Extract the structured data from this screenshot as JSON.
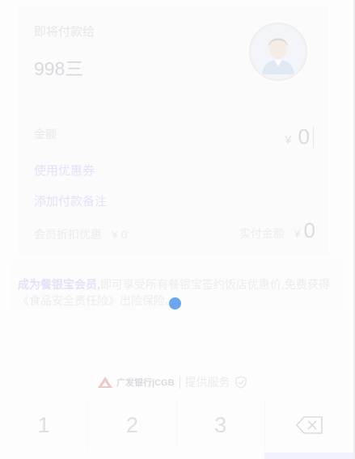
{
  "payment": {
    "pay_to_label": "即将付款给",
    "merchant_name": "998三",
    "amount_label": "金额",
    "currency_symbol": "¥",
    "amount_value": "0",
    "use_coupon_label": "使用优惠券",
    "add_remark_label": "添加付款备注",
    "member_discount_label": "会员折扣优惠",
    "member_discount_value": "¥ 0",
    "actual_amount_label": "实付金额",
    "actual_amount_value": "0"
  },
  "promo": {
    "highlight": "成为餐银宝会员,",
    "rest": "即可享受所有餐银宝签约饭店优惠价,免费获得《食品安全责任险》出险保险。"
  },
  "provider": {
    "bank_name": "广发银行|CGB",
    "provided_by": "提供服务"
  },
  "keypad": {
    "keys": [
      "1",
      "2",
      "3"
    ],
    "delete_icon": "backspace-icon"
  },
  "colors": {
    "accent": "#6aa6ef",
    "link": "#e2e2fb",
    "bank_red": "#e8c8c8"
  }
}
